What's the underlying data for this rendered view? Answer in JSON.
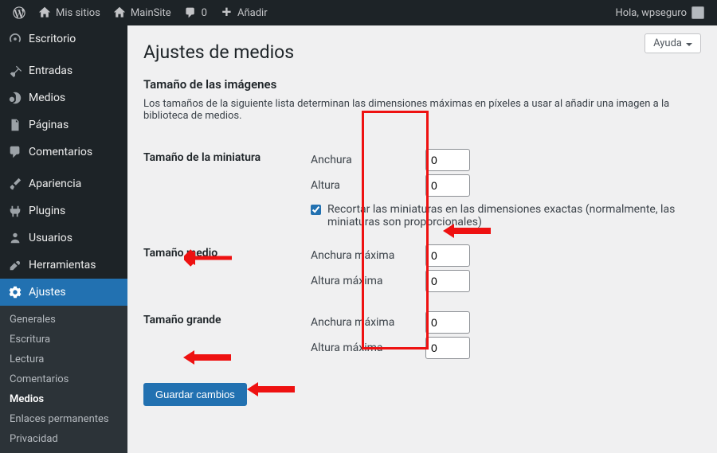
{
  "adminbar": {
    "mysites": "Mis sitios",
    "sitename": "MainSite",
    "comments": "0",
    "add": "Añadir",
    "greeting": "Hola, wpseguro"
  },
  "menu": {
    "dashboard": "Escritorio",
    "posts": "Entradas",
    "media": "Medios",
    "pages": "Páginas",
    "comments": "Comentarios",
    "appearance": "Apariencia",
    "plugins": "Plugins",
    "users": "Usuarios",
    "tools": "Herramientas",
    "settings": "Ajustes"
  },
  "submenu": {
    "general": "Generales",
    "writing": "Escritura",
    "reading": "Lectura",
    "discussion": "Comentarios",
    "media": "Medios",
    "permalinks": "Enlaces permanentes",
    "privacy": "Privacidad"
  },
  "page": {
    "help": "Ayuda",
    "title": "Ajustes de medios",
    "section": "Tamaño de las imágenes",
    "desc": "Los tamaños de la siguiente lista determinan las dimensiones máximas en píxeles a usar al añadir una imagen a la biblioteca de medios."
  },
  "thumb": {
    "label": "Tamaño de la miniatura",
    "w_label": "Anchura",
    "h_label": "Altura",
    "w": 0,
    "h": 0,
    "crop": "Recortar las miniaturas en las dimensiones exactas (normalmente, las miniaturas son proporcionales)"
  },
  "medium": {
    "label": "Tamaño medio",
    "w_label": "Anchura máxima",
    "h_label": "Altura máxima",
    "w": 0,
    "h": 0
  },
  "large": {
    "label": "Tamaño grande",
    "w_label": "Anchura máxima",
    "h_label": "Altura máxima",
    "w": 0,
    "h": 0
  },
  "submit": "Guardar cambios"
}
